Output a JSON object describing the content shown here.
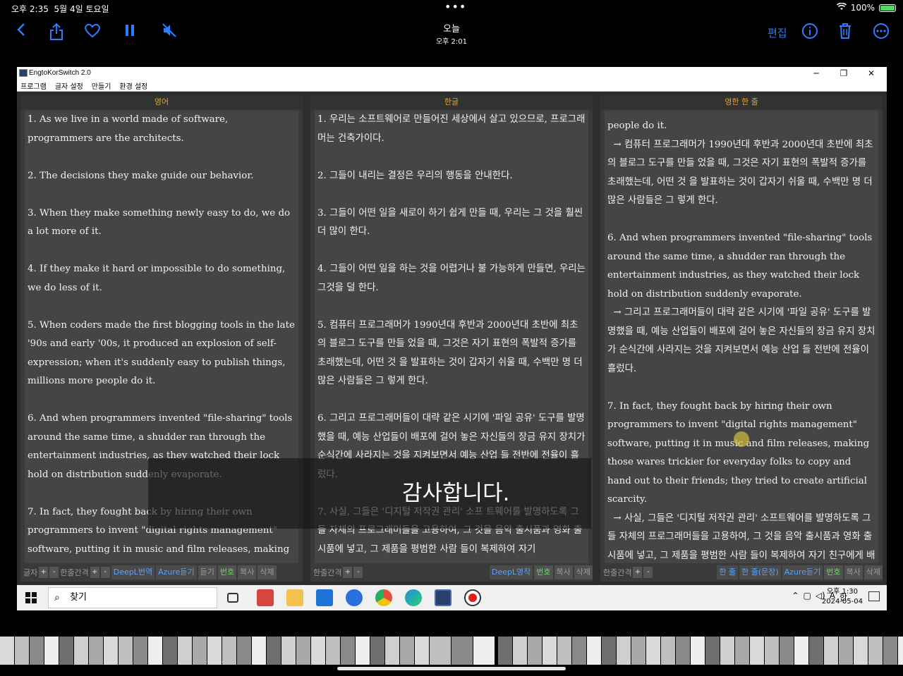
{
  "status": {
    "time": "오후 2:35",
    "date": "5월 4일 토요일",
    "battery": "100%",
    "dots": "•••"
  },
  "photo_toolbar": {
    "title": "오늘",
    "subtitle": "오후 2:01",
    "edit_label": "편집",
    "icons": [
      "back-icon",
      "share-icon",
      "heart-icon",
      "pause-icon",
      "mute-icon",
      "info-icon",
      "trash-icon",
      "more-icon"
    ],
    "accent": "#2f7dff"
  },
  "app": {
    "title": "EngtoKorSwitch 2.0",
    "menu": [
      "프로그램",
      "글자 설정",
      "만들기",
      "환경 설정"
    ],
    "window_controls": [
      "─",
      "❐",
      "✕"
    ]
  },
  "panes": {
    "english": {
      "header": "영어",
      "paragraphs": [
        "1. As we live in a world made of software, programmers are the architects.",
        "2. The decisions they make guide our behavior.",
        "3. When they make something newly easy to do, we do a lot more of it.",
        "4. If they make it hard or impossible to do something, we do less of it.",
        "5. When coders made the first blogging tools in the late '90s and early '00s, it produced an explosion of self- expression; when it's suddenly easy to publish things, millions more people do it.",
        "6. And when programmers invented \"file-sharing\" tools around the same time, a shudder ran through the entertainment industries, as they watched their lock hold on distribution suddenly evaporate.",
        "7. In fact, they fought back by hiring their own programmers to invent \"digital rights management\" software, putting it in music and film releases, making"
      ],
      "footer": {
        "label1": "글자",
        "label2": "한줄간격",
        "buttons": [
          "DeepL번역",
          "Azure듣기",
          "듣기",
          "번호",
          "복사",
          "삭제"
        ]
      }
    },
    "korean": {
      "header": "한글",
      "paragraphs": [
        "1. 우리는 소프트웨어로 만들어진 세상에서 살고 있으므로, 프로그래머는 건축가이다.",
        "2. 그들이 내리는 결정은 우리의 행동을 안내한다.",
        "3. 그들이 어떤 일을 새로이 하기 쉽게 만들 때, 우리는 그 것을 훨씬 더 많이 한다.",
        "4. 그들이 어떤 일을 하는 것을 어렵거나 불 가능하게 만들면, 우리는 그것을 덜 한다.",
        "5. 컴퓨터 프로그래머가 1990년대 후반과 2000년대 초반에 최초의 블로그 도구를 만들 었을 때, 그것은 자기 표현의 폭발적 증가를 초래했는데, 어떤 것 을 발표하는 것이 갑자기 쉬울 때, 수백만 명 더 많은 사람들은 그 렇게 한다.",
        "6. 그리고 프로그래머들이 대략 같은 시기에 '파일 공유' 도구를 발명했을 때, 예능 산업들이 배포에 걸어 놓은 자신들의 장금 유지 장치가 순식간에 사라지는 것을 지켜보면서 예능 산업 들 전반에 전율이 흘렀다.",
        "7. 사실, 그들은 '디지털 저작권 관리' 소프 트웨어를 발명하도록 그들 자체의 프로그래머들을 고용하여, 그 것을 음악 출시품과 영화 출시품에 넣고, 그 제품을 평범한 사람 들이 복제하여 자기"
      ],
      "footer": {
        "label1": "한줄간격",
        "buttons": [
          "DeepL영작",
          "번호",
          "복사",
          "삭제"
        ]
      }
    },
    "combined": {
      "header": "영한 한 줄",
      "paragraphs": [
        "people do it.\n  → 컴퓨터 프로그래머가 1990년대 후반과 2000년대 초반에 최초의 블로그 도구를 만들 었을 때, 그것은 자기 표현의 폭발적 증가를 초래했는데, 어떤 것 을 발표하는 것이 갑자기 쉬울 때, 수백만 명 더 많은 사람들은 그 렇게 한다.",
        "6. And when programmers invented \"file-sharing\" tools around the same time, a shudder ran through the entertainment industries, as they watched their lock hold on distribution suddenly evaporate.\n  → 그리고 프로그래머들이 대략 같은 시기에 '파일 공유' 도구를 발명했을 때, 예능 산업들이 배포에 걸어 놓은 자신들의 장금 유지 장치가 순식간에 사라지는 것을 지켜보면서 예능 산업 들 전반에 전율이 흘렀다.",
        "7. In fact, they fought back by hiring their own programmers to invent \"digital rights management\" software, putting it in music and film releases, making those wares trickier for everyday folks to copy and hand out to their friends; they tried to create artificial scarcity.\n  → 사실, 그들은 '디지털 저작권 관리' 소프트웨어를 발명하도록 그들 자체의 프로그래머들을 고용하여, 그 것을 음악 출시품과 영화 출시품에 넣고, 그 제품을 평범한 사람 들이 복제하여 자기 친구에게 배포하기가 더 까다로워지도록 만 들으려서"
      ],
      "footer": {
        "label1": "한줄간격",
        "buttons": [
          "한 줄",
          "한 줄(문장)",
          "Azure듣기",
          "번호",
          "복사",
          "삭제"
        ]
      }
    }
  },
  "overlay_subtitle": "감사합니다.",
  "taskbar": {
    "search_placeholder": "찾기",
    "time": "오후 1:30",
    "date": "2024-05-04",
    "ime": "A",
    "ime2": "한"
  }
}
